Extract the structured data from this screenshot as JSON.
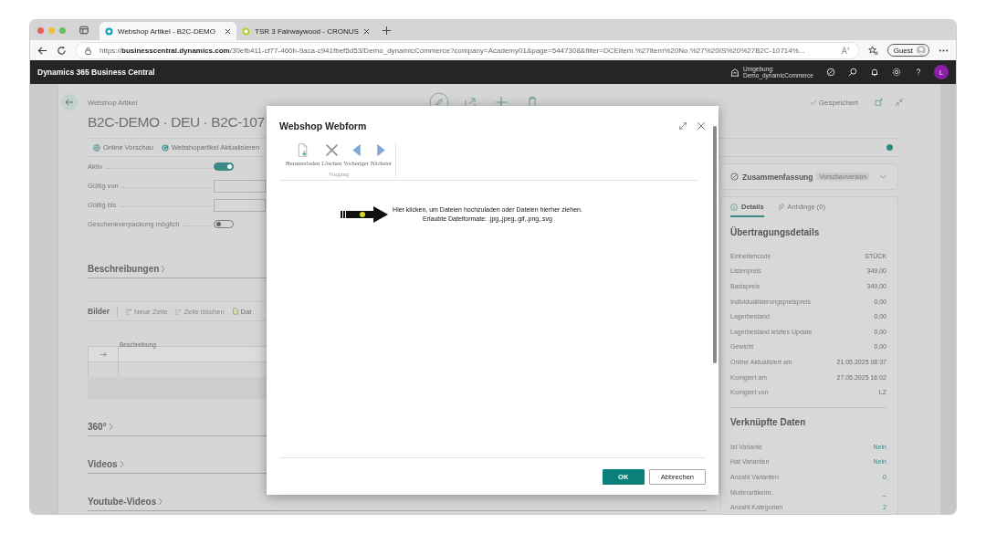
{
  "browser": {
    "tabs": [
      {
        "title": "Webshop Artikel - B2C-DEMO",
        "selected": true
      },
      {
        "title": "TSR 3 Fairwaywood - CRONUS",
        "selected": false
      }
    ],
    "url_prefix": "https://",
    "url_host": "businesscentral.dynamics.com",
    "url_rest": "/30efb411-cf77-460b-9aca-c941fbef5d53/Demo_dynamicCommerce?company=Academy01&page=5447308&filter=DCEItem.%27Item%20No.%27%20IS%20%27B2C-10714%...",
    "profile": "Guest"
  },
  "app": {
    "title": "Dynamics 365 Business Central",
    "environment_label": "Umgebung:",
    "environment": "Demo_dynamicCommerce",
    "avatar": "L"
  },
  "page": {
    "breadcrumb": "Webshop Artikel",
    "title": "B2C-DEMO · DEU · B2C-107",
    "status": "Gespeichert",
    "actions": [
      {
        "label": "Online Vorschau",
        "kind": "globe"
      },
      {
        "label": "Webshopartikel Aktualisieren",
        "kind": "refresh"
      }
    ],
    "fields": [
      {
        "label": "Aktiv",
        "kind": "toggle",
        "on": true
      },
      {
        "label": "Gültig von",
        "kind": "input"
      },
      {
        "label": "Gültig bis",
        "kind": "input"
      },
      {
        "label": "Geschenkverpackung möglich",
        "kind": "toggle",
        "on": false
      }
    ],
    "section_top": "Beschreibungen",
    "images": {
      "title": "Bilder",
      "actions": [
        {
          "label": "Neue Zeile",
          "kind": "new"
        },
        {
          "label": "Zeile löschen",
          "kind": "delete"
        },
        {
          "label": "Dat",
          "kind": "file"
        }
      ],
      "column": "Beschreibung",
      "rows": [
        {
          "current": true
        },
        {
          "current": false
        }
      ]
    },
    "sections": [
      "360°",
      "Videos",
      "Youtube-Videos"
    ]
  },
  "summary": {
    "title": "Zusammenfassung",
    "badge": "Vorschauversion",
    "tabs": [
      {
        "label": "Details",
        "selected": true
      },
      {
        "label": "Anhänge (0)",
        "selected": false
      }
    ],
    "groups": [
      {
        "title": "Übertragungsdetails",
        "rows": [
          {
            "label": "Einheitencode",
            "value": "STÜCK",
            "link": false
          },
          {
            "label": "Listenpreis",
            "value": "349,00",
            "link": false
          },
          {
            "label": "Basispreis",
            "value": "349,00",
            "link": false
          },
          {
            "label": "Individualisierungspreispreis",
            "value": "0,00",
            "link": false
          },
          {
            "label": "Lagerbestand",
            "value": "0,00",
            "link": false
          },
          {
            "label": "Lagerbestand letztes Update",
            "value": "0,00",
            "link": false
          },
          {
            "label": "Gewicht",
            "value": "0,00",
            "link": false
          },
          {
            "label": "Online Aktualisiert am",
            "value": "21.05.2025 08:37",
            "link": false
          },
          {
            "label": "Korrigiert am",
            "value": "27.05.2025 16:02",
            "link": false
          },
          {
            "label": "Korrigiert von",
            "value": "LZ",
            "link": false
          }
        ]
      },
      {
        "title": "Verknüpfte Daten",
        "rows": [
          {
            "label": "Ist Variante",
            "value": "Nein",
            "link": true
          },
          {
            "label": "Hat Varianten",
            "value": "Nein",
            "link": true
          },
          {
            "label": "Anzahl Varianten",
            "value": "0",
            "link": true
          },
          {
            "label": "Mutterartikelnr.",
            "value": "_",
            "link": false
          },
          {
            "label": "Anzahl Kategorien",
            "value": "2",
            "link": true
          }
        ]
      }
    ]
  },
  "dialog": {
    "title": "Webshop Webform",
    "group": "Vorgang",
    "tools": [
      {
        "label": "Herunterladen",
        "kind": "download"
      },
      {
        "label": "Löschen",
        "kind": "delete"
      },
      {
        "label": "Vorheriger",
        "kind": "prev"
      },
      {
        "label": "Nächster",
        "kind": "next"
      }
    ],
    "upload_lines": [
      "Hier klicken, um Dateien hochzuladen oder Dateien hierher ziehen.",
      "Erlaubte Dateiformate: .jpg,.jpeg,.gif,.png,.svg"
    ],
    "buttons": [
      {
        "label": "OK",
        "kind": "primary"
      },
      {
        "label": "Abbrechen",
        "kind": "secondary"
      }
    ]
  }
}
